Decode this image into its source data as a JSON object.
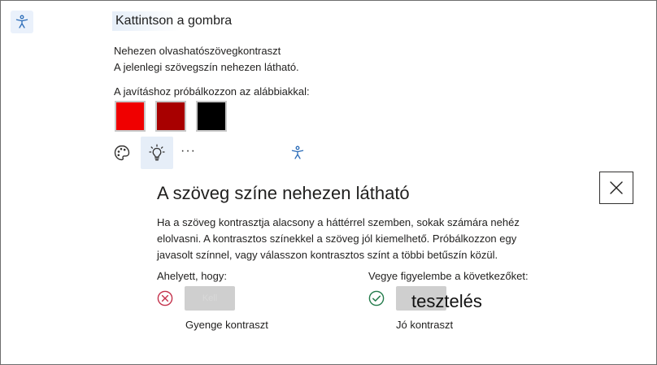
{
  "prompt": {
    "click_button_label": "Kattintson a gombra",
    "issue_title": "Nehezen olvashatószövegkontraszt",
    "issue_description": "A jelenlegi szövegszín nehezen látható.",
    "suggestion_label": "A javításhoz próbálkozzon az alábbiakkal:"
  },
  "swatches": [
    {
      "name": "bright-red",
      "color": "#f00000"
    },
    {
      "name": "dark-red",
      "color": "#a80000"
    },
    {
      "name": "black",
      "color": "#000000"
    }
  ],
  "toolbar": {
    "more_label": "···"
  },
  "panel": {
    "heading": "A szöveg színe nehezen látható",
    "body": "Ha a szöveg kontrasztja alacsony a háttérrel szemben, sokak számára nehéz elolvasni. A kontrasztos színekkel a szöveg jól kiemelhető. Próbálkozzon egy javasolt színnel, vagy válasszon kontrasztos színt a többi betűszín közül.",
    "instead_label": "Ahelyett, hogy:",
    "bad_sample_text": "Kell",
    "bad_caption": "Gyenge kontraszt",
    "consider_label": "Vegye figyelembe a következőket:",
    "good_sample_text": "tesztelés",
    "good_caption": "Jó kontraszt"
  },
  "icons": {
    "accessibility": "accessibility-icon",
    "palette": "palette-icon",
    "lightbulb": "lightbulb-icon",
    "close": "close-icon",
    "error": "error-circle-icon",
    "success": "check-circle-icon"
  },
  "colors": {
    "accent_blue": "#2b6cb8",
    "error_red": "#c4314b",
    "success_green": "#237b4b",
    "sample_gray": "#cfcfcf"
  }
}
